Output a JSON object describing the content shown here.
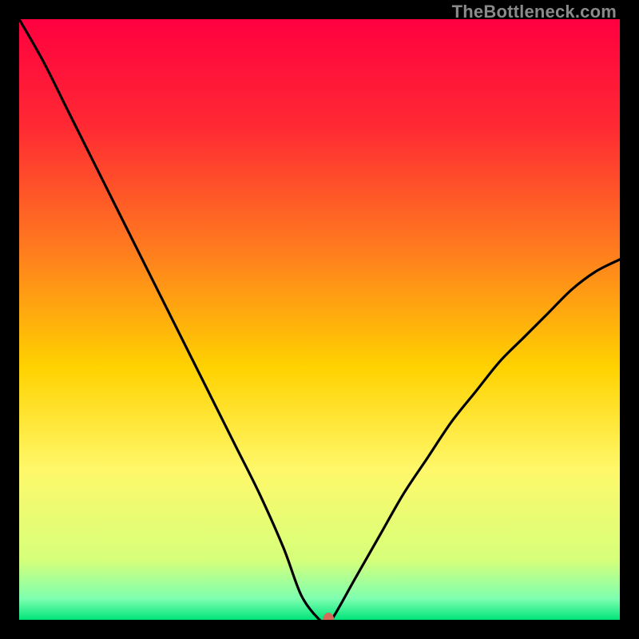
{
  "watermark": "TheBottleneck.com",
  "chart_data": {
    "type": "line",
    "title": "",
    "xlabel": "",
    "ylabel": "",
    "xlim": [
      0,
      100
    ],
    "ylim": [
      0,
      100
    ],
    "grid": false,
    "legend": false,
    "background_gradient": {
      "stops": [
        {
          "offset": 0.0,
          "color": "#ff0040"
        },
        {
          "offset": 0.18,
          "color": "#ff2a33"
        },
        {
          "offset": 0.38,
          "color": "#ff7a1f"
        },
        {
          "offset": 0.58,
          "color": "#ffd200"
        },
        {
          "offset": 0.75,
          "color": "#fff86a"
        },
        {
          "offset": 0.9,
          "color": "#d6ff7a"
        },
        {
          "offset": 0.965,
          "color": "#7dffb0"
        },
        {
          "offset": 1.0,
          "color": "#00e47a"
        }
      ]
    },
    "series": [
      {
        "name": "bottleneck-curve",
        "x": [
          0,
          4,
          8,
          12,
          16,
          20,
          24,
          28,
          32,
          36,
          40,
          44,
          47,
          50,
          51,
          52,
          56,
          60,
          64,
          68,
          72,
          76,
          80,
          84,
          88,
          92,
          96,
          100
        ],
        "y": [
          100,
          93,
          85,
          77,
          69,
          61,
          53,
          45,
          37,
          29,
          21,
          12,
          4,
          0,
          0,
          0,
          7,
          14,
          21,
          27,
          33,
          38,
          43,
          47,
          51,
          55,
          58,
          60
        ]
      }
    ],
    "marker": {
      "x": 51.5,
      "y": 0,
      "color": "#d46a5a",
      "rx": 7,
      "ry": 9
    }
  }
}
